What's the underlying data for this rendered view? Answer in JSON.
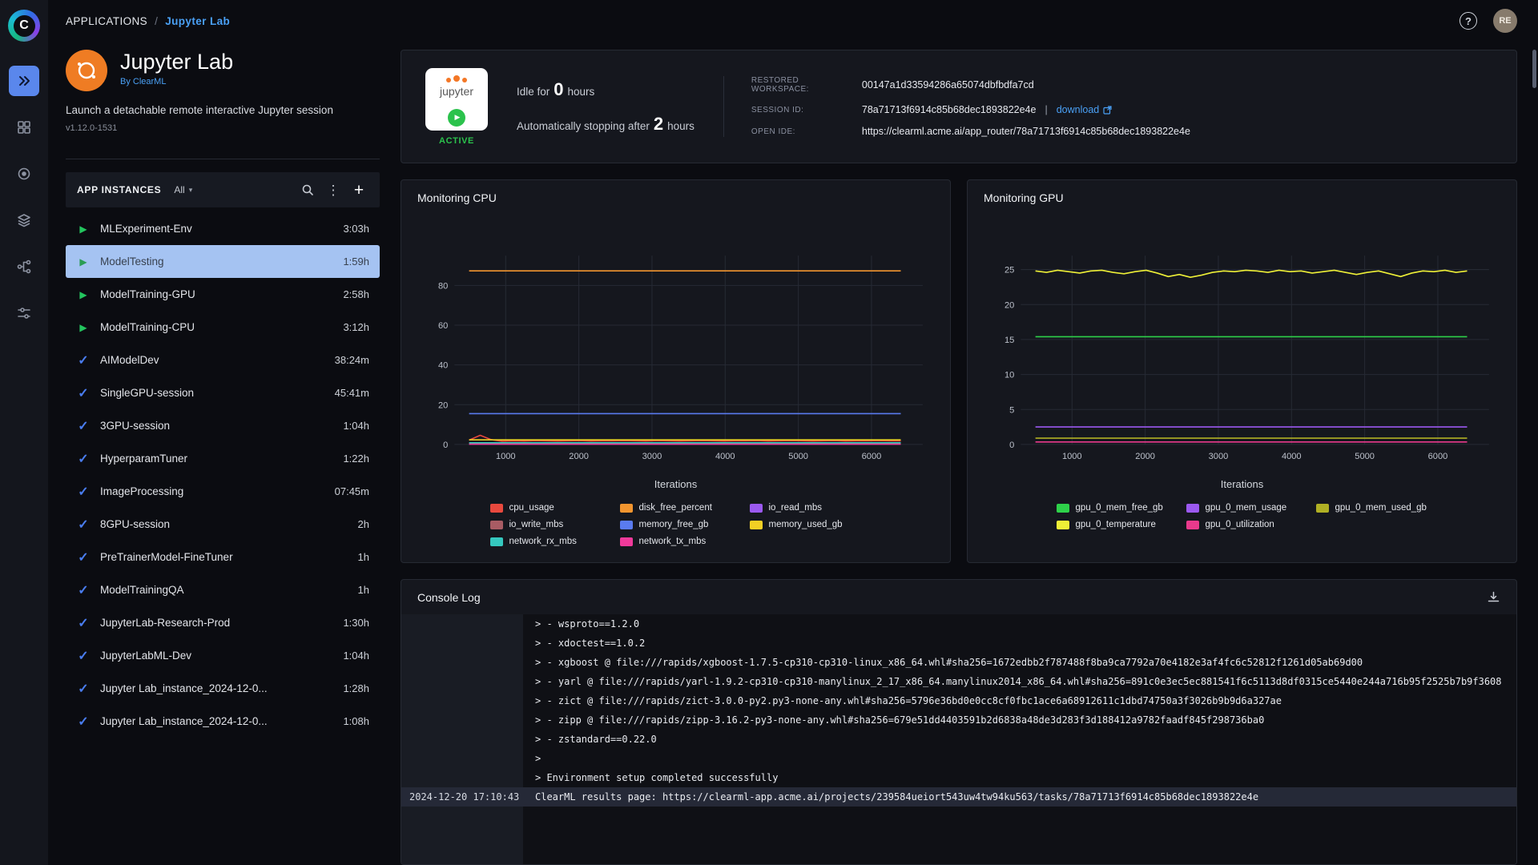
{
  "topbar": {
    "breadcrumb_root": "APPLICATIONS",
    "breadcrumb_sep": "/",
    "breadcrumb_current": "Jupyter Lab",
    "help_label": "?",
    "avatar_initials": "RE"
  },
  "logo_letter": "C",
  "app_panel": {
    "title": "Jupyter Lab",
    "byline": "By ClearML",
    "description": "Launch a detachable remote interactive Jupyter session",
    "version": "v1.12.0-1531",
    "instances_title": "APP INSTANCES",
    "filter_value": "All",
    "instances": [
      {
        "name": "MLExperiment-Env",
        "time": "3:03h",
        "status": "running",
        "selected": false
      },
      {
        "name": "ModelTesting",
        "time": "1:59h",
        "status": "running",
        "selected": true
      },
      {
        "name": "ModelTraining-GPU",
        "time": "2:58h",
        "status": "running",
        "selected": false
      },
      {
        "name": "ModelTraining-CPU",
        "time": "3:12h",
        "status": "running",
        "selected": false
      },
      {
        "name": "AIModelDev",
        "time": "38:24m",
        "status": "completed",
        "selected": false
      },
      {
        "name": "SingleGPU-session",
        "time": "45:41m",
        "status": "completed",
        "selected": false
      },
      {
        "name": "3GPU-session",
        "time": "1:04h",
        "status": "completed",
        "selected": false
      },
      {
        "name": "HyperparamTuner",
        "time": "1:22h",
        "status": "completed",
        "selected": false
      },
      {
        "name": "ImageProcessing",
        "time": "07:45m",
        "status": "completed",
        "selected": false
      },
      {
        "name": "8GPU-session",
        "time": "2h",
        "status": "completed",
        "selected": false
      },
      {
        "name": "PreTrainerModel-FineTuner",
        "time": "1h",
        "status": "completed",
        "selected": false
      },
      {
        "name": "ModelTrainingQA",
        "time": "1h",
        "status": "completed",
        "selected": false
      },
      {
        "name": "JupyterLab-Research-Prod",
        "time": "1:30h",
        "status": "completed",
        "selected": false
      },
      {
        "name": "JupyterLabML-Dev",
        "time": "1:04h",
        "status": "completed",
        "selected": false
      },
      {
        "name": "Jupyter Lab_instance_2024-12-0...",
        "time": "1:28h",
        "status": "completed",
        "selected": false
      },
      {
        "name": "Jupyter Lab_instance_2024-12-0...",
        "time": "1:08h",
        "status": "completed",
        "selected": false
      }
    ]
  },
  "session": {
    "badge_text": "jupyter",
    "status": "ACTIVE",
    "idle_prefix": "Idle for",
    "idle_value": "0",
    "idle_suffix": "hours",
    "autostop_prefix": "Automatically stopping after",
    "autostop_value": "2",
    "autostop_suffix": "hours",
    "restored_label": "RESTORED WORKSPACE:",
    "restored_value": "00147a1d33594286a65074dbfbdfa7cd",
    "session_id_label": "SESSION ID:",
    "session_id_value": "78a71713f6914c85b68dec1893822e4e",
    "value_divider": "|",
    "download_label": "download",
    "open_ide_label": "OPEN IDE:",
    "open_ide_value": "https://clearml.acme.ai/app_router/78a71713f6914c85b68dec1893822e4e"
  },
  "chart_data": [
    {
      "type": "line",
      "title": "Monitoring CPU",
      "xlabel": "Iterations",
      "grid": true,
      "legend_position": "bottom",
      "x_range": [
        300,
        6700
      ],
      "data_x": [
        500,
        6400
      ],
      "xticks": [
        1000,
        2000,
        3000,
        4000,
        5000,
        6000
      ],
      "ylim": [
        0,
        95
      ],
      "yticks": [
        0,
        20,
        40,
        60,
        80
      ],
      "series": [
        {
          "name": "cpu_usage",
          "color": "#e8493e",
          "values": [
            2.2,
            4.6,
            2.4,
            1.6,
            1.8,
            1.7,
            1.9,
            1.8,
            1.7,
            1.8,
            1.9,
            1.7,
            1.8,
            1.8,
            1.9,
            1.8,
            1.7,
            1.9,
            1.8,
            1.7,
            1.8,
            1.9,
            1.8,
            1.7,
            1.8,
            1.8,
            1.9,
            1.7,
            1.8,
            1.9,
            1.8,
            1.7,
            1.8,
            1.9,
            1.7,
            1.8,
            1.8,
            1.9,
            1.8,
            1.8
          ]
        },
        {
          "name": "disk_free_percent",
          "color": "#f2952f",
          "value": 87.3
        },
        {
          "name": "io_read_mbs",
          "color": "#9b59f0",
          "value": 0.25
        },
        {
          "name": "io_write_mbs",
          "color": "#a85c64",
          "value": 0.55
        },
        {
          "name": "memory_free_gb",
          "color": "#5a7bf0",
          "value": 15.5
        },
        {
          "name": "memory_used_gb",
          "color": "#f2d024",
          "value": 2.3
        },
        {
          "name": "network_rx_mbs",
          "color": "#35c8bf",
          "value": 0.85
        },
        {
          "name": "network_tx_mbs",
          "color": "#f03a9b",
          "value": 0.12
        }
      ]
    },
    {
      "type": "line",
      "title": "Monitoring GPU",
      "xlabel": "Iterations",
      "grid": true,
      "legend_position": "bottom",
      "x_range": [
        300,
        6700
      ],
      "data_x": [
        500,
        6400
      ],
      "xticks": [
        1000,
        2000,
        3000,
        4000,
        5000,
        6000
      ],
      "ylim": [
        0,
        27
      ],
      "yticks": [
        0,
        5,
        10,
        15,
        20,
        25
      ],
      "series": [
        {
          "name": "gpu_0_mem_free_gb",
          "color": "#2ed14a",
          "value": 15.4
        },
        {
          "name": "gpu_0_mem_usage",
          "color": "#9b59f0",
          "value": 2.5
        },
        {
          "name": "gpu_0_mem_used_gb",
          "color": "#b0b024",
          "value": 0.9
        },
        {
          "name": "gpu_0_temperature",
          "color": "#eef037",
          "values": [
            24.8,
            24.6,
            24.9,
            24.7,
            24.5,
            24.8,
            24.9,
            24.6,
            24.4,
            24.7,
            24.9,
            24.5,
            24.0,
            24.3,
            23.9,
            24.2,
            24.6,
            24.8,
            24.7,
            24.9,
            24.8,
            24.6,
            24.9,
            24.7,
            24.8,
            24.5,
            24.7,
            24.9,
            24.6,
            24.3,
            24.6,
            24.8,
            24.4,
            24.0,
            24.5,
            24.8,
            24.7,
            24.9,
            24.6,
            24.8
          ]
        },
        {
          "name": "gpu_0_utilization",
          "color": "#e83a8c",
          "value": 0.35
        }
      ]
    }
  ],
  "console": {
    "title": "Console Log",
    "lines": [
      {
        "ts": "",
        "text": "> - wsproto==1.2.0"
      },
      {
        "ts": "",
        "text": "> - xdoctest==1.0.2"
      },
      {
        "ts": "",
        "text": "> - xgboost @ file:///rapids/xgboost-1.7.5-cp310-cp310-linux_x86_64.whl#sha256=1672edbb2f787488f8ba9ca7792a70e4182e3af4fc6c52812f1261d05ab69d00"
      },
      {
        "ts": "",
        "text": "> - yarl @ file:///rapids/yarl-1.9.2-cp310-cp310-manylinux_2_17_x86_64.manylinux2014_x86_64.whl#sha256=891c0e3ec5ec881541f6c5113d8df0315ce5440e244a716b95f2525b7b9f3608"
      },
      {
        "ts": "",
        "text": "> - zict @ file:///rapids/zict-3.0.0-py2.py3-none-any.whl#sha256=5796e36bd0e0cc8cf0fbc1ace6a68912611c1dbd74750a3f3026b9b9d6a327ae"
      },
      {
        "ts": "",
        "text": "> - zipp @ file:///rapids/zipp-3.16.2-py3-none-any.whl#sha256=679e51dd4403591b2d6838a48de3d283f3d188412a9782faadf845f298736ba0"
      },
      {
        "ts": "",
        "text": "> - zstandard==0.22.0"
      },
      {
        "ts": "",
        "text": ">"
      },
      {
        "ts": "",
        "text": "> Environment setup completed successfully"
      },
      {
        "ts": "2024-12-20 17:10:43",
        "text": "ClearML results page: https://clearml-app.acme.ai/projects/239584ueiort543uw4tw94ku563/tasks/78a71713f6914c85b68dec1893822e4e",
        "highlight": true
      }
    ]
  }
}
